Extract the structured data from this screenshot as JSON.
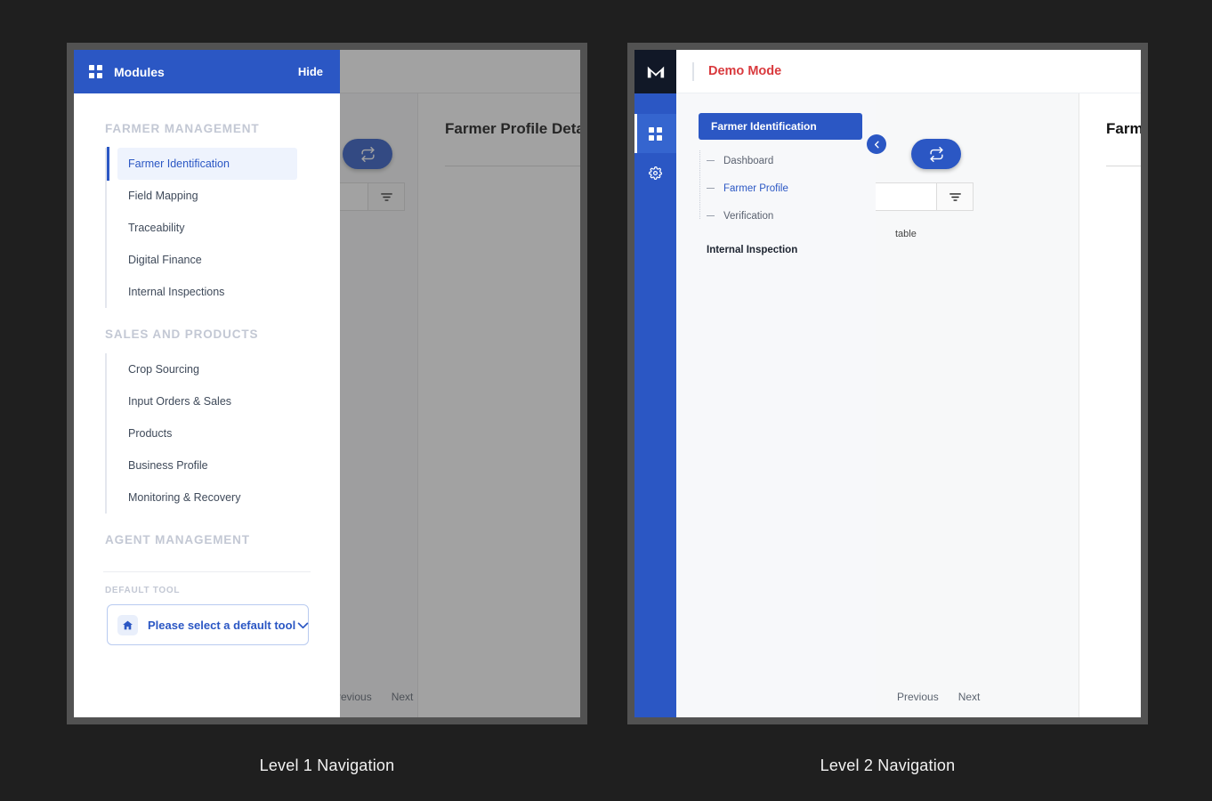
{
  "theme": {
    "brand_blue": "#2b57c4",
    "rail_dark": "#111827",
    "demo_red": "#d93a3e",
    "active_bg": "#eef3fd",
    "page_bg": "#1f1f1f",
    "frame_border": "#525252"
  },
  "captions": {
    "level1": "Level 1 Navigation",
    "level2": "Level 2 Navigation"
  },
  "panel1": {
    "drawer": {
      "grid_icon": "grid-icon",
      "title": "Modules",
      "hide_label": "Hide",
      "groups": [
        {
          "title": "FARMER MANAGEMENT",
          "items": [
            {
              "label": "Farmer Identification",
              "active": true
            },
            {
              "label": "Field Mapping",
              "active": false
            },
            {
              "label": "Traceability",
              "active": false
            },
            {
              "label": "Digital Finance",
              "active": false
            },
            {
              "label": "Internal Inspections",
              "active": false
            }
          ]
        },
        {
          "title": "SALES AND PRODUCTS",
          "items": [
            {
              "label": "Crop Sourcing",
              "active": false
            },
            {
              "label": "Input Orders & Sales",
              "active": false
            },
            {
              "label": "Products",
              "active": false
            },
            {
              "label": "Business Profile",
              "active": false
            },
            {
              "label": "Monitoring & Recovery",
              "active": false
            }
          ]
        },
        {
          "title": "AGENT MANAGEMENT",
          "items": []
        }
      ],
      "default_tool": {
        "label": "DEFAULT TOOL",
        "icon": "home-icon",
        "value": "Please select a default tool",
        "caret": "chevron-down-icon"
      }
    },
    "background": {
      "detail_title": "Farmer Profile Details",
      "swap_button_icon": "swap-icon",
      "filter_button_icon": "filter-icon",
      "pager": {
        "previous": "Previous",
        "next": "Next"
      }
    }
  },
  "panel2": {
    "rail": {
      "logo": "M",
      "items": [
        {
          "icon": "grid-icon",
          "name": "modules",
          "active": true
        },
        {
          "icon": "gear-icon",
          "name": "settings",
          "active": false
        }
      ]
    },
    "topbar": {
      "demo_mode": "Demo Mode"
    },
    "submenu": {
      "header": "Farmer Identification",
      "items": [
        {
          "label": "Dashboard",
          "current": false
        },
        {
          "label": "Farmer Profile",
          "current": true
        },
        {
          "label": "Verification",
          "current": false
        }
      ],
      "group": "Internal Inspection",
      "collapse_icon": "chevron-left-icon"
    },
    "content": {
      "detail_title": "Farmer Profile Details",
      "swap_button_icon": "swap-icon",
      "filter_button_icon": "filter-icon",
      "table_hint": "table",
      "pager": {
        "previous": "Previous",
        "next": "Next"
      }
    }
  }
}
